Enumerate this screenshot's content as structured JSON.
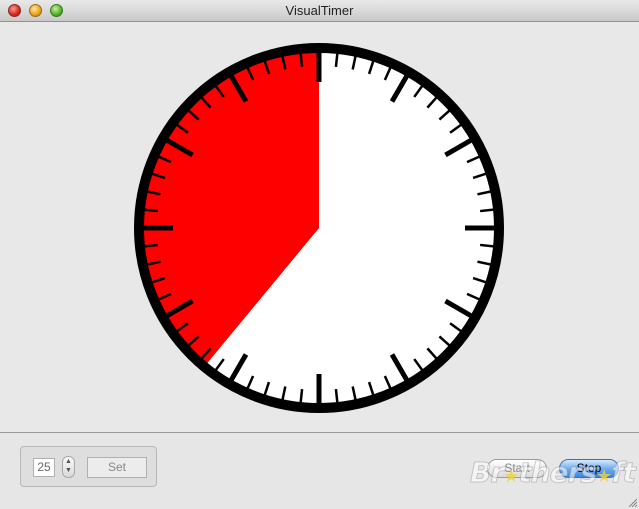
{
  "window": {
    "title": "VisualTimer"
  },
  "timer": {
    "remaining_fraction": 0.39,
    "colors": {
      "remaining": "#ff0000",
      "face": "#ffffff",
      "ring": "#000000"
    }
  },
  "controls": {
    "minutes_value": "25",
    "set_label": "Set",
    "start_label": "Start",
    "stop_label": "Stop"
  },
  "watermark": {
    "text_a": "Br",
    "text_b": "thers",
    "text_c": "ft"
  }
}
